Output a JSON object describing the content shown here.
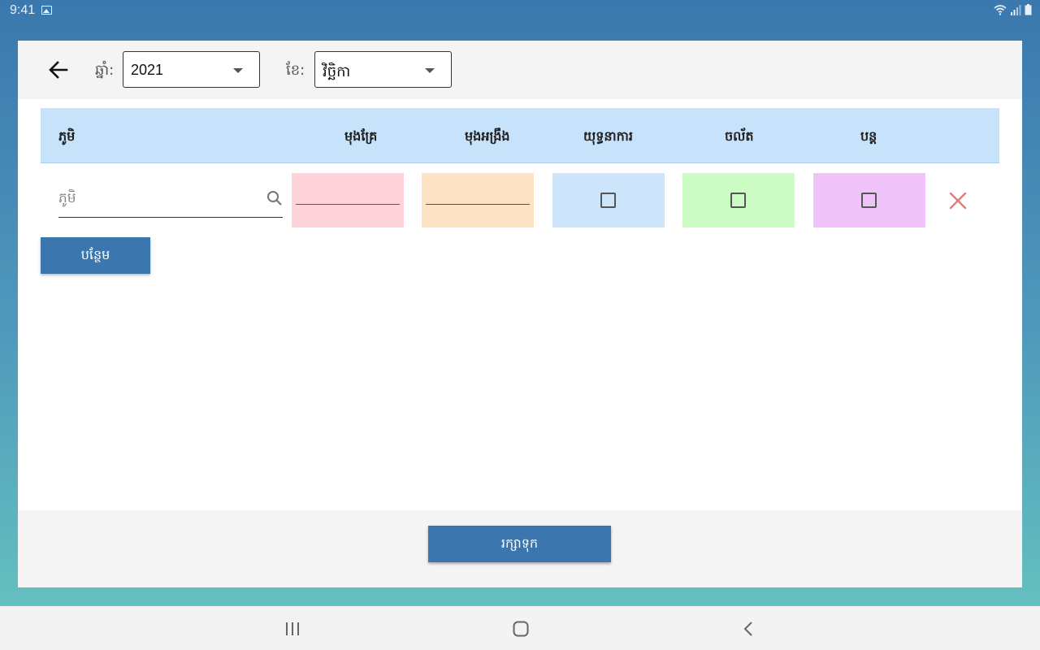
{
  "status_bar": {
    "time": "9:41"
  },
  "toolbar": {
    "year_label": "ឆ្នាំ:",
    "year_value": "2021",
    "month_label": "ខែ:",
    "month_value": "វិច្ឆិកា"
  },
  "table": {
    "headers": [
      "ភូមិ",
      "មុងគ្រែ",
      "មុងអង្រឹង",
      "យុទ្ធនាការ",
      "ចល័ត",
      "បន្ត"
    ],
    "row": {
      "search_placeholder": "ភូមិ",
      "cell_colors": [
        "#fdd2d9",
        "#fde2c4",
        "#cce5fb",
        "#ccfcc4",
        "#f0c4fa"
      ]
    }
  },
  "add_button_label": "បន្ថែម",
  "save_button_label": "រក្សាទុក",
  "colors": {
    "accent": "#3b77ae",
    "header_bg": "#c6e3fb",
    "delete": "#e07c7c"
  }
}
